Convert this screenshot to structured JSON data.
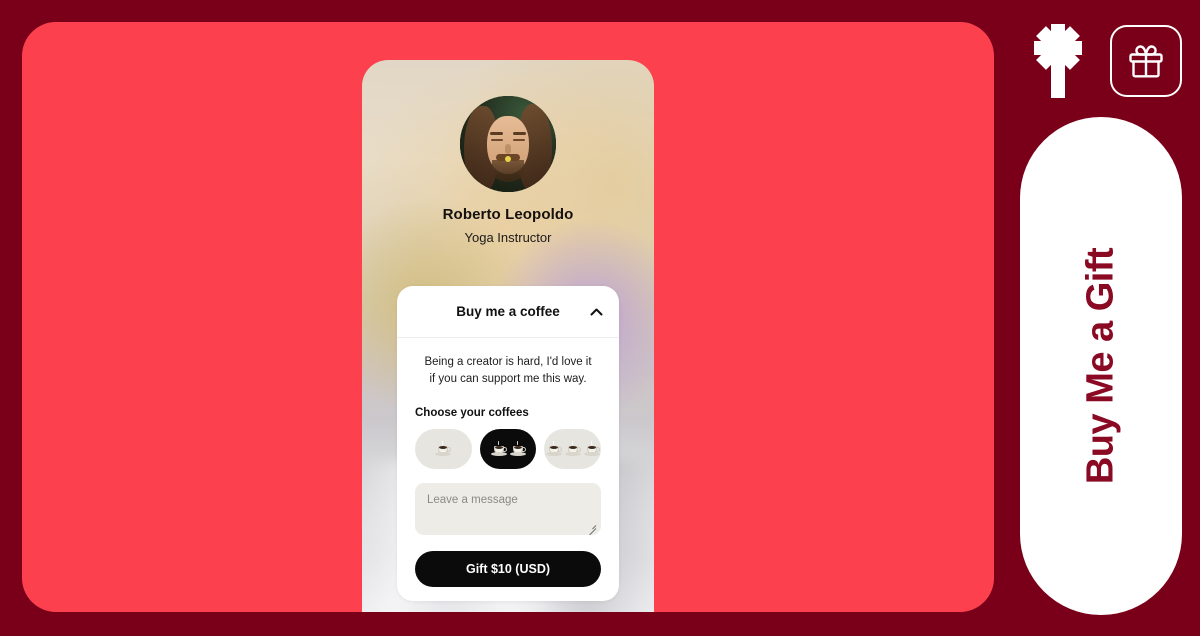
{
  "theme": {
    "background_color": "#7A0019",
    "panel_color": "#FC404E",
    "accent_color": "#8A0A24",
    "pill_color": "#FFFFFF",
    "button_color": "#0B0B0B"
  },
  "brand": {
    "asterisk_icon": "asterisk-logo-icon",
    "gift_icon": "gift-icon",
    "pill_text": "Buy Me a Gift"
  },
  "phone": {
    "profile": {
      "avatar_alt": "avatar",
      "name": "Roberto Leopoldo",
      "role": "Yoga Instructor"
    },
    "card": {
      "title": "Buy me a coffee",
      "collapse_icon": "chevron-up-icon",
      "blurb": "Being a creator is hard, I'd love it if you can support me this way.",
      "choose_label": "Choose your coffees",
      "coffee_options": [
        {
          "id": "one-coffee",
          "count": 1,
          "selected": false
        },
        {
          "id": "two-coffees",
          "count": 2,
          "selected": true
        },
        {
          "id": "three-coffees",
          "count": 3,
          "selected": false
        }
      ],
      "message": {
        "value": "",
        "placeholder": "Leave a message"
      },
      "submit_label": "Gift $10 (USD)"
    }
  }
}
